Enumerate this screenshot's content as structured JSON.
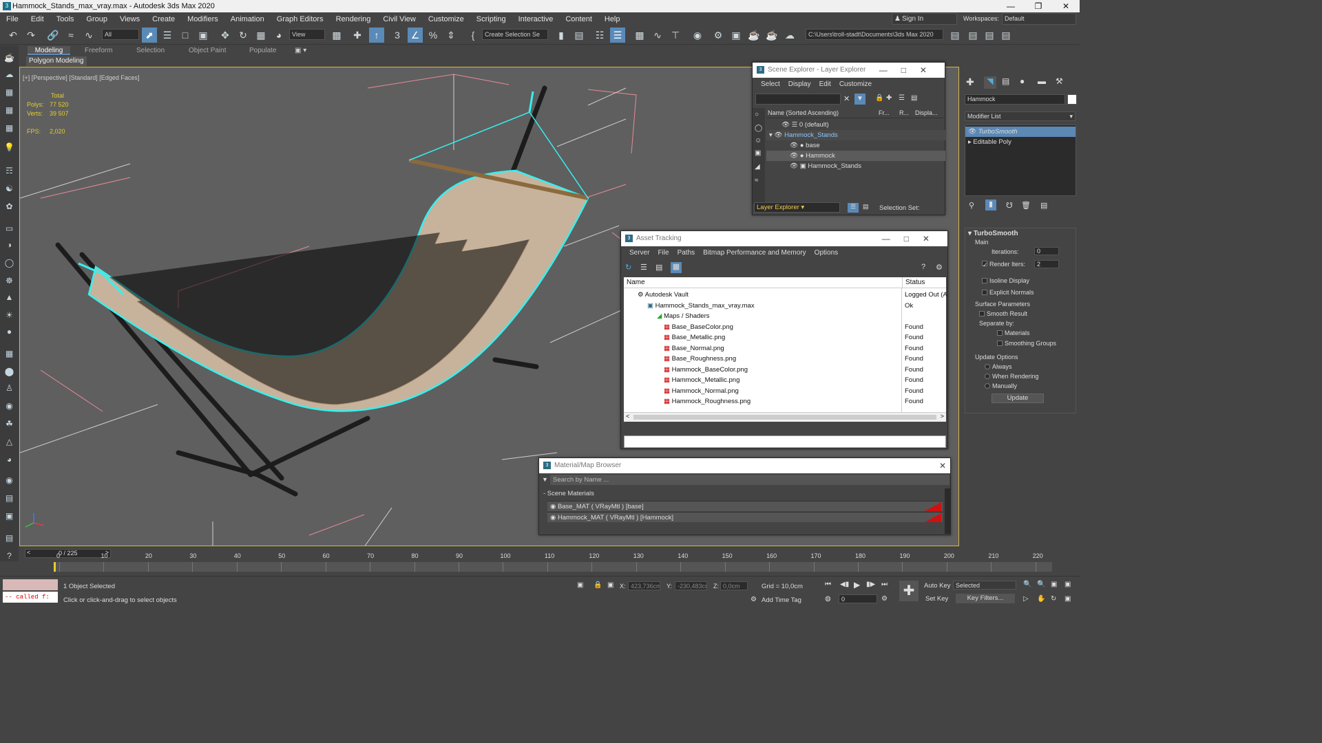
{
  "title": "Hammock_Stands_max_vray.max - Autodesk 3ds Max 2020",
  "menu": [
    "File",
    "Edit",
    "Tools",
    "Group",
    "Views",
    "Create",
    "Modifiers",
    "Animation",
    "Graph Editors",
    "Rendering",
    "Civil View",
    "Customize",
    "Scripting",
    "Interactive",
    "Content",
    "Help"
  ],
  "account": {
    "sign_in": "Sign In",
    "workspaces_label": "Workspaces:",
    "workspace": "Default"
  },
  "toolbar": {
    "selection_filter": "All",
    "ref_coord": "View",
    "named_selection": "Create Selection Se",
    "project_path": "C:\\Users\\troll-stadt\\Documents\\3ds Max 2020"
  },
  "ribbon": {
    "tabs": [
      "Modeling",
      "Freeform",
      "Selection",
      "Object Paint",
      "Populate"
    ],
    "sub": "Polygon Modeling"
  },
  "viewport": {
    "label": "[+] [Perspective] [Standard] [Edged Faces]",
    "stats_total": "Total",
    "polys_label": "Polys:",
    "polys": "77 520",
    "verts_label": "Verts:",
    "verts": "39 507",
    "fps_label": "FPS:",
    "fps": "2,020"
  },
  "scene_explorer": {
    "title": "Scene Explorer - Layer Explorer",
    "menu": [
      "Select",
      "Display",
      "Edit",
      "Customize"
    ],
    "columns": [
      "Name (Sorted Ascending)",
      "Fr...",
      "R...",
      "Displa..."
    ],
    "rows": [
      {
        "name": "0 (default)"
      },
      {
        "name": "Hammock_Stands"
      },
      {
        "name": "base"
      },
      {
        "name": "Hammock"
      },
      {
        "name": "Hammock_Stands"
      }
    ],
    "footer_dropdown": "Layer Explorer",
    "selection_set": "Selection Set:"
  },
  "asset_tracking": {
    "title": "Asset Tracking",
    "menu": [
      "Server",
      "File",
      "Paths",
      "Bitmap Performance and Memory",
      "Options"
    ],
    "columns": [
      "Name",
      "Status"
    ],
    "rows": [
      {
        "name": "Autodesk Vault",
        "status": "Logged Out (A"
      },
      {
        "name": "Hammock_Stands_max_vray.max",
        "status": "Ok"
      },
      {
        "name": "Maps / Shaders",
        "status": ""
      },
      {
        "name": "Base_BaseColor.png",
        "status": "Found"
      },
      {
        "name": "Base_Metallic.png",
        "status": "Found"
      },
      {
        "name": "Base_Normal.png",
        "status": "Found"
      },
      {
        "name": "Base_Roughness.png",
        "status": "Found"
      },
      {
        "name": "Hammock_BaseColor.png",
        "status": "Found"
      },
      {
        "name": "Hammock_Metallic.png",
        "status": "Found"
      },
      {
        "name": "Hammock_Normal.png",
        "status": "Found"
      },
      {
        "name": "Hammock_Roughness.png",
        "status": "Found"
      }
    ]
  },
  "material_browser": {
    "title": "Material/Map Browser",
    "search_placeholder": "Search by Name ...",
    "section": "- Scene Materials",
    "materials": [
      "Base_MAT ( VRayMtl ) [base]",
      "Hammock_MAT ( VRayMtl ) [Hammock]"
    ]
  },
  "command_panel": {
    "object_name": "Hammock",
    "modifier_list": "Modifier List",
    "stack": [
      "TurboSmooth",
      "Editable Poly"
    ],
    "rollout": "TurboSmooth",
    "main": "Main",
    "iterations_label": "Iterations:",
    "iterations": "0",
    "render_iters_label": "Render Iters:",
    "render_iters": "2",
    "isoline": "Isoline Display",
    "explicit": "Explicit Normals",
    "surface_params": "Surface Parameters",
    "smooth_result": "Smooth Result",
    "separate_by": "Separate by:",
    "materials": "Materials",
    "smoothing_groups": "Smoothing Groups",
    "update_options": "Update Options",
    "always": "Always",
    "when_rendering": "When Rendering",
    "manually": "Manually",
    "update_button": "Update"
  },
  "timeline": {
    "frame": "0 / 225",
    "ticks": [
      "0",
      "10",
      "20",
      "30",
      "40",
      "50",
      "60",
      "70",
      "80",
      "90",
      "100",
      "110",
      "120",
      "130",
      "140",
      "150",
      "160",
      "170",
      "180",
      "190",
      "200",
      "210",
      "220"
    ]
  },
  "status": {
    "script_text": "-- called f:",
    "selected": "1 Object Selected",
    "prompt": "Click or click-and-drag to select objects",
    "x_label": "X:",
    "x": "423,736cm",
    "y_label": "Y:",
    "y": "-230,483cm",
    "z_label": "Z:",
    "z": "0,0cm",
    "grid": "Grid = 10,0cm",
    "add_time_tag": "Add Time Tag",
    "auto_key": "Auto Key",
    "set_key": "Set Key",
    "key_mode": "Selected",
    "key_filters": "Key Filters...",
    "frame_field": "0"
  }
}
